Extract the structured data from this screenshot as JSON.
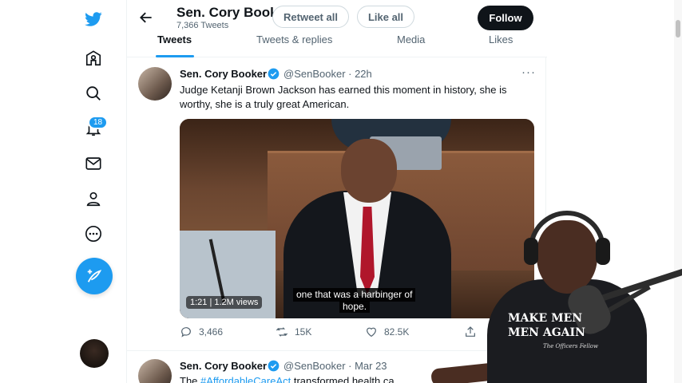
{
  "header": {
    "name": "Sen. Cory Booker",
    "tweet_count": "7,366 Tweets",
    "retweet_all": "Retweet all",
    "like_all": "Like all",
    "follow": "Follow"
  },
  "tabs": [
    "Tweets",
    "Tweets & replies",
    "Media",
    "Likes"
  ],
  "rail": {
    "notifications_badge": "18"
  },
  "tweet": {
    "name": "Sen. Cory Booker",
    "handle": "@SenBooker · 22h",
    "more": "···",
    "text": "Judge Ketanji Brown Jackson has earned this moment in history, she is worthy, she is a truly great American.",
    "video_views": "1:21 | 1.2M views",
    "caption_line1": "one that was a harbinger of",
    "caption_line2": "hope.",
    "replies": "3,466",
    "retweets": "15K",
    "likes": "82.5K"
  },
  "tweet2": {
    "name": "Sen. Cory Booker",
    "handle": "@SenBooker · Mar 23",
    "text_prefix": "The ",
    "hashtag": "#AffordableCareAct",
    "text_suffix": " transformed health ca"
  },
  "overlay": {
    "shirt_line1": "MAKE MEN",
    "shirt_line2": "MEN AGAIN",
    "shirt_sub": "The Officers Fellow"
  },
  "colors": {
    "accent": "#1d9bf0",
    "text": "#0f1419",
    "muted": "#536471"
  }
}
